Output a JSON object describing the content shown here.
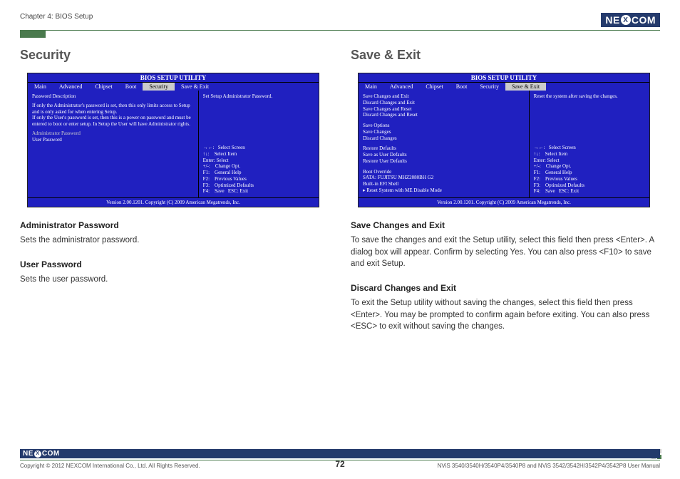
{
  "header": {
    "chapter": "Chapter 4: BIOS Setup",
    "brand_left": "NE",
    "brand_right": "COM",
    "brand_x": "X"
  },
  "left": {
    "title": "Security",
    "bios": {
      "title": "BIOS SETUP UTILITY",
      "menu": [
        "Main",
        "Advanced",
        "Chipset",
        "Boot",
        "Security",
        "Save & Exit"
      ],
      "active_index": 4,
      "left_panel": {
        "line1": "Password Description",
        "para": "If only the Administrator's password is set, then this only limits access to Setup and is only asked for when entering Setup.\nIf only the User's password is set, then this is a power on password and must be entered to boot or enter setup. In Setup the User will have Administrator rights.",
        "item1": "Administrator Password",
        "item2": "User Password"
      },
      "right_panel": {
        "help": "Set Setup Administrator Password.",
        "nav": "→←:   Select Screen\n↑↓:    Select Item\nEnter: Select\n+/-:    Change Opt.\nF1:    General Help\nF2:    Previous Values\nF3:    Optimized Defaults\nF4:    Save   ESC: Exit"
      },
      "footer": "Version 2.00.1201. Copyright (C) 2009 American Megatrends, Inc."
    },
    "sub1_h": "Administrator Password",
    "sub1_t": "Sets the administrator password.",
    "sub2_h": "User Password",
    "sub2_t": "Sets the user password."
  },
  "right": {
    "title": "Save & Exit",
    "bios": {
      "title": "BIOS SETUP UTILITY",
      "menu": [
        "Main",
        "Advanced",
        "Chipset",
        "Boot",
        "Security",
        "Save & Exit"
      ],
      "active_index": 5,
      "left_panel": {
        "g1": "Save Changes and Exit\nDiscard Changes and Exit\nSave Changes and Reset\nDiscard Changes and Reset",
        "g2h": "Save Options",
        "g2": "Save Changes\nDiscard Changes",
        "g3": "Restore Defaults\nSave as User Defaults\nRestore User Defaults",
        "g4h": "Boot Override",
        "g4a": "SATA: FUJITSU MHZ2080BH G2",
        "g4b": "Built-in EFI Shell",
        "g4c": "▸  Reset System with ME Disable Mode"
      },
      "right_panel": {
        "help": "Reset the system after saving the changes.",
        "nav": "→←:   Select Screen\n↑↓:    Select Item\nEnter: Select\n+/-:    Change Opt.\nF1:    General Help\nF2:    Previous Values\nF3:    Optimized Defaults\nF4:    Save   ESC: Exit"
      },
      "footer": "Version 2.00.1201. Copyright (C) 2009 American Megatrends, Inc."
    },
    "sub1_h": "Save Changes and Exit",
    "sub1_t": "To save the changes and exit the Setup utility, select this field then press <Enter>. A dialog box will appear. Confirm by selecting Yes. You can also press <F10> to save and exit Setup.",
    "sub2_h": "Discard Changes and Exit",
    "sub2_t": "To exit the Setup utility without saving the changes, select this field then press <Enter>. You may be prompted to confirm again before exiting. You can also press <ESC> to exit without saving the changes."
  },
  "footer": {
    "copyright": "Copyright © 2012 NEXCOM International Co., Ltd. All Rights Reserved.",
    "manual": "NViS 3540/3540H/3540P4/3540P8 and NViS 3542/3542H/3542P4/3542P8 User Manual",
    "page": "72"
  }
}
